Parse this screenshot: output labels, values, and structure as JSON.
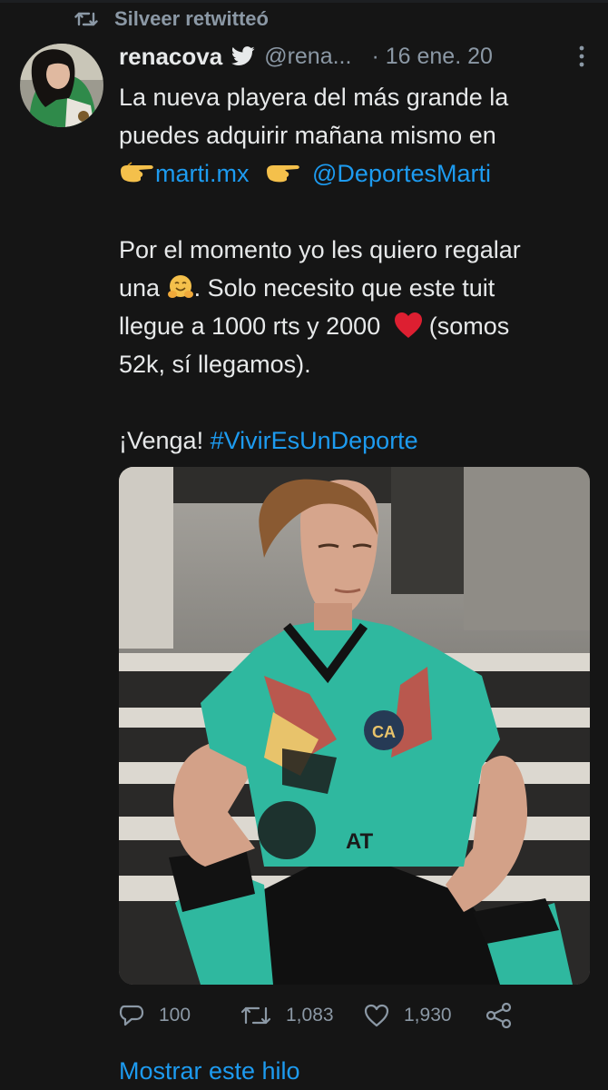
{
  "retweet": {
    "label": "Silveer retwitteó",
    "icon": "retweet-icon"
  },
  "author": {
    "name": "renacova",
    "handle": "@rena...",
    "date": "· 16 ene. 20",
    "verified": true
  },
  "tweet": {
    "line1": "La nueva playera del más grande la",
    "line2": "puedes adquirir mañana mismo en",
    "link1": "marti.mx",
    "mention": "@DeportesMarti",
    "line4": "Por el momento yo les quiero regalar",
    "line5a": "una",
    "line5b": ". Solo necesito que este tuit",
    "line6a": "llegue a 1000 rts y 2000",
    "line6b": "(somos",
    "line7": "52k, sí llegamos).",
    "line8a": "¡Venga!",
    "hashtag": "#VivirEsUnDeporte"
  },
  "actions": {
    "replies": "100",
    "retweets": "1,083",
    "likes": "1,930"
  },
  "show_thread": "Mostrar este hilo",
  "colors": {
    "background": "#151515",
    "text": "#e7e9ea",
    "secondary": "#8b98a5",
    "link": "#1d9bf0",
    "jersey": "#2fb89f"
  }
}
